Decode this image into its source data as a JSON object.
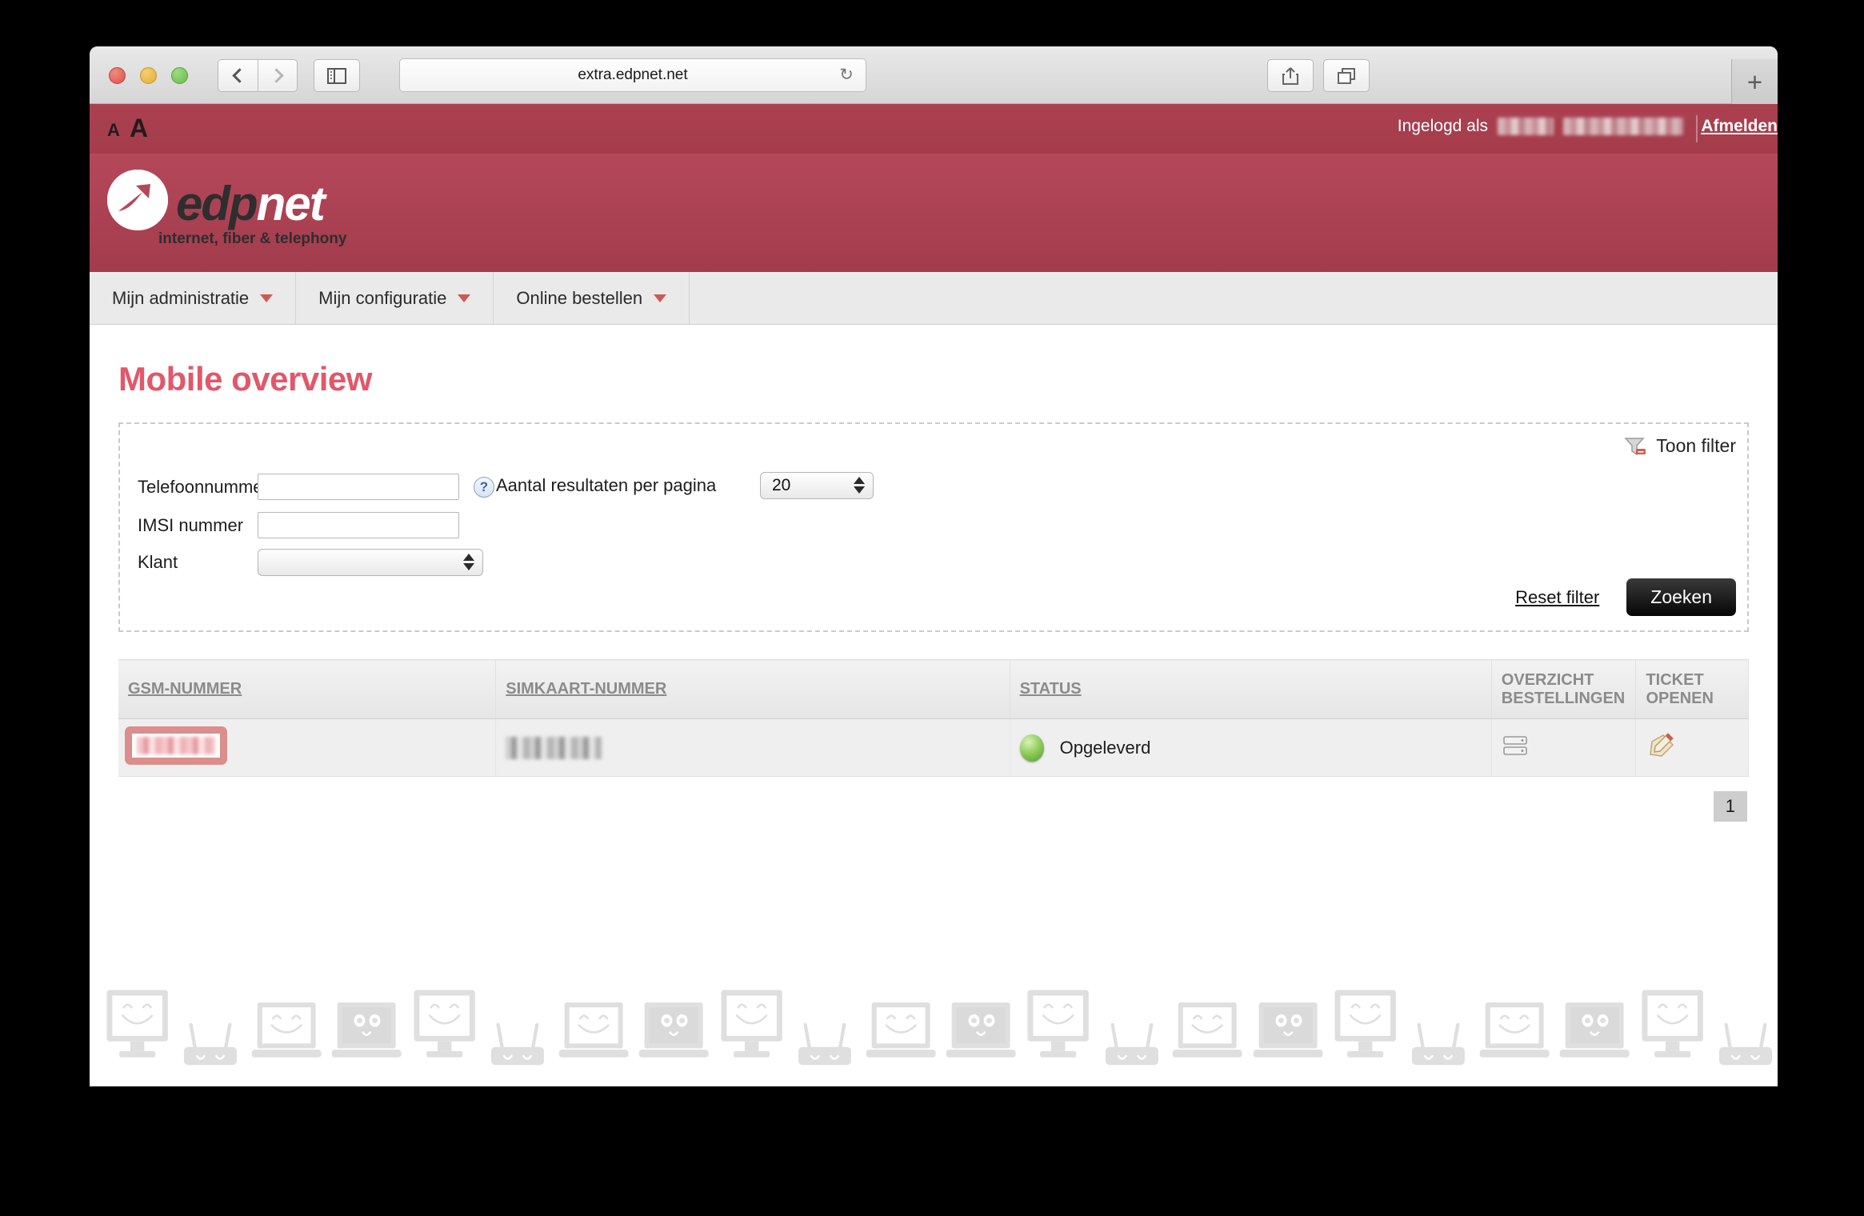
{
  "browser": {
    "url": "extra.edpnet.net",
    "reload_glyph": "↻",
    "newtab_glyph": "+",
    "back_icon": "back-chevron-icon",
    "forward_icon": "forward-chevron-icon",
    "sidebar_icon": "sidebar-toggle-icon",
    "share_icon": "share-icon",
    "tabs_icon": "show-tabs-icon"
  },
  "topbar": {
    "font_small": "A",
    "font_large": "A",
    "login_prefix": "Ingelogd als",
    "login_user_redacted": "",
    "logout": "Afmelden"
  },
  "brand": {
    "name_first": "edp",
    "name_second": "net",
    "tagline": "internet, fiber & telephony",
    "logo_icon": "edpnet-arrow-logo-icon"
  },
  "nav": {
    "items": [
      {
        "label": "Mijn administratie"
      },
      {
        "label": "Mijn configuratie"
      },
      {
        "label": "Online bestellen"
      }
    ]
  },
  "page": {
    "title": "Mobile overview"
  },
  "filter": {
    "toggle_label": "Toon filter",
    "toggle_icon": "filter-funnel-icon",
    "telefoonnummer_label": "Telefoonnummer",
    "telefoonnummer_value": "",
    "telefoonnummer_placeholder": "",
    "help_icon": "help-question-icon",
    "help_glyph": "?",
    "imsi_label": "IMSI nummer",
    "imsi_value": "",
    "imsi_placeholder": "",
    "klant_label": "Klant",
    "klant_value": "",
    "perpage_label": "Aantal resultaten per pagina",
    "perpage_value": "20",
    "perpage_options": [
      "20"
    ],
    "reset_label": "Reset filter",
    "search_label": "Zoeken"
  },
  "table": {
    "columns": [
      {
        "label": "GSM-NUMMER",
        "sortable": true
      },
      {
        "label": "SIMKAART-NUMMER",
        "sortable": true
      },
      {
        "label": "STATUS",
        "sortable": true
      },
      {
        "label": "OVERZICHT BESTELLINGEN",
        "sortable": false
      },
      {
        "label": "TICKET OPENEN",
        "sortable": false
      }
    ],
    "rows": [
      {
        "gsm": "",
        "sim": "",
        "status": "Opgeleverd",
        "status_color": "#7cc24b",
        "overzicht_icon": "orders-overview-icon",
        "ticket_icon": "open-ticket-pencil-icon"
      }
    ]
  },
  "pagination": {
    "current_page": "1"
  },
  "footer": {
    "art_icon": "smiling-devices-pattern-icon"
  },
  "colors": {
    "brand_red": "#a8404f",
    "title_pink": "#e2576a",
    "highlight": "#db8e8c",
    "status_green": "#7cc24b",
    "button_black": "#050505"
  }
}
